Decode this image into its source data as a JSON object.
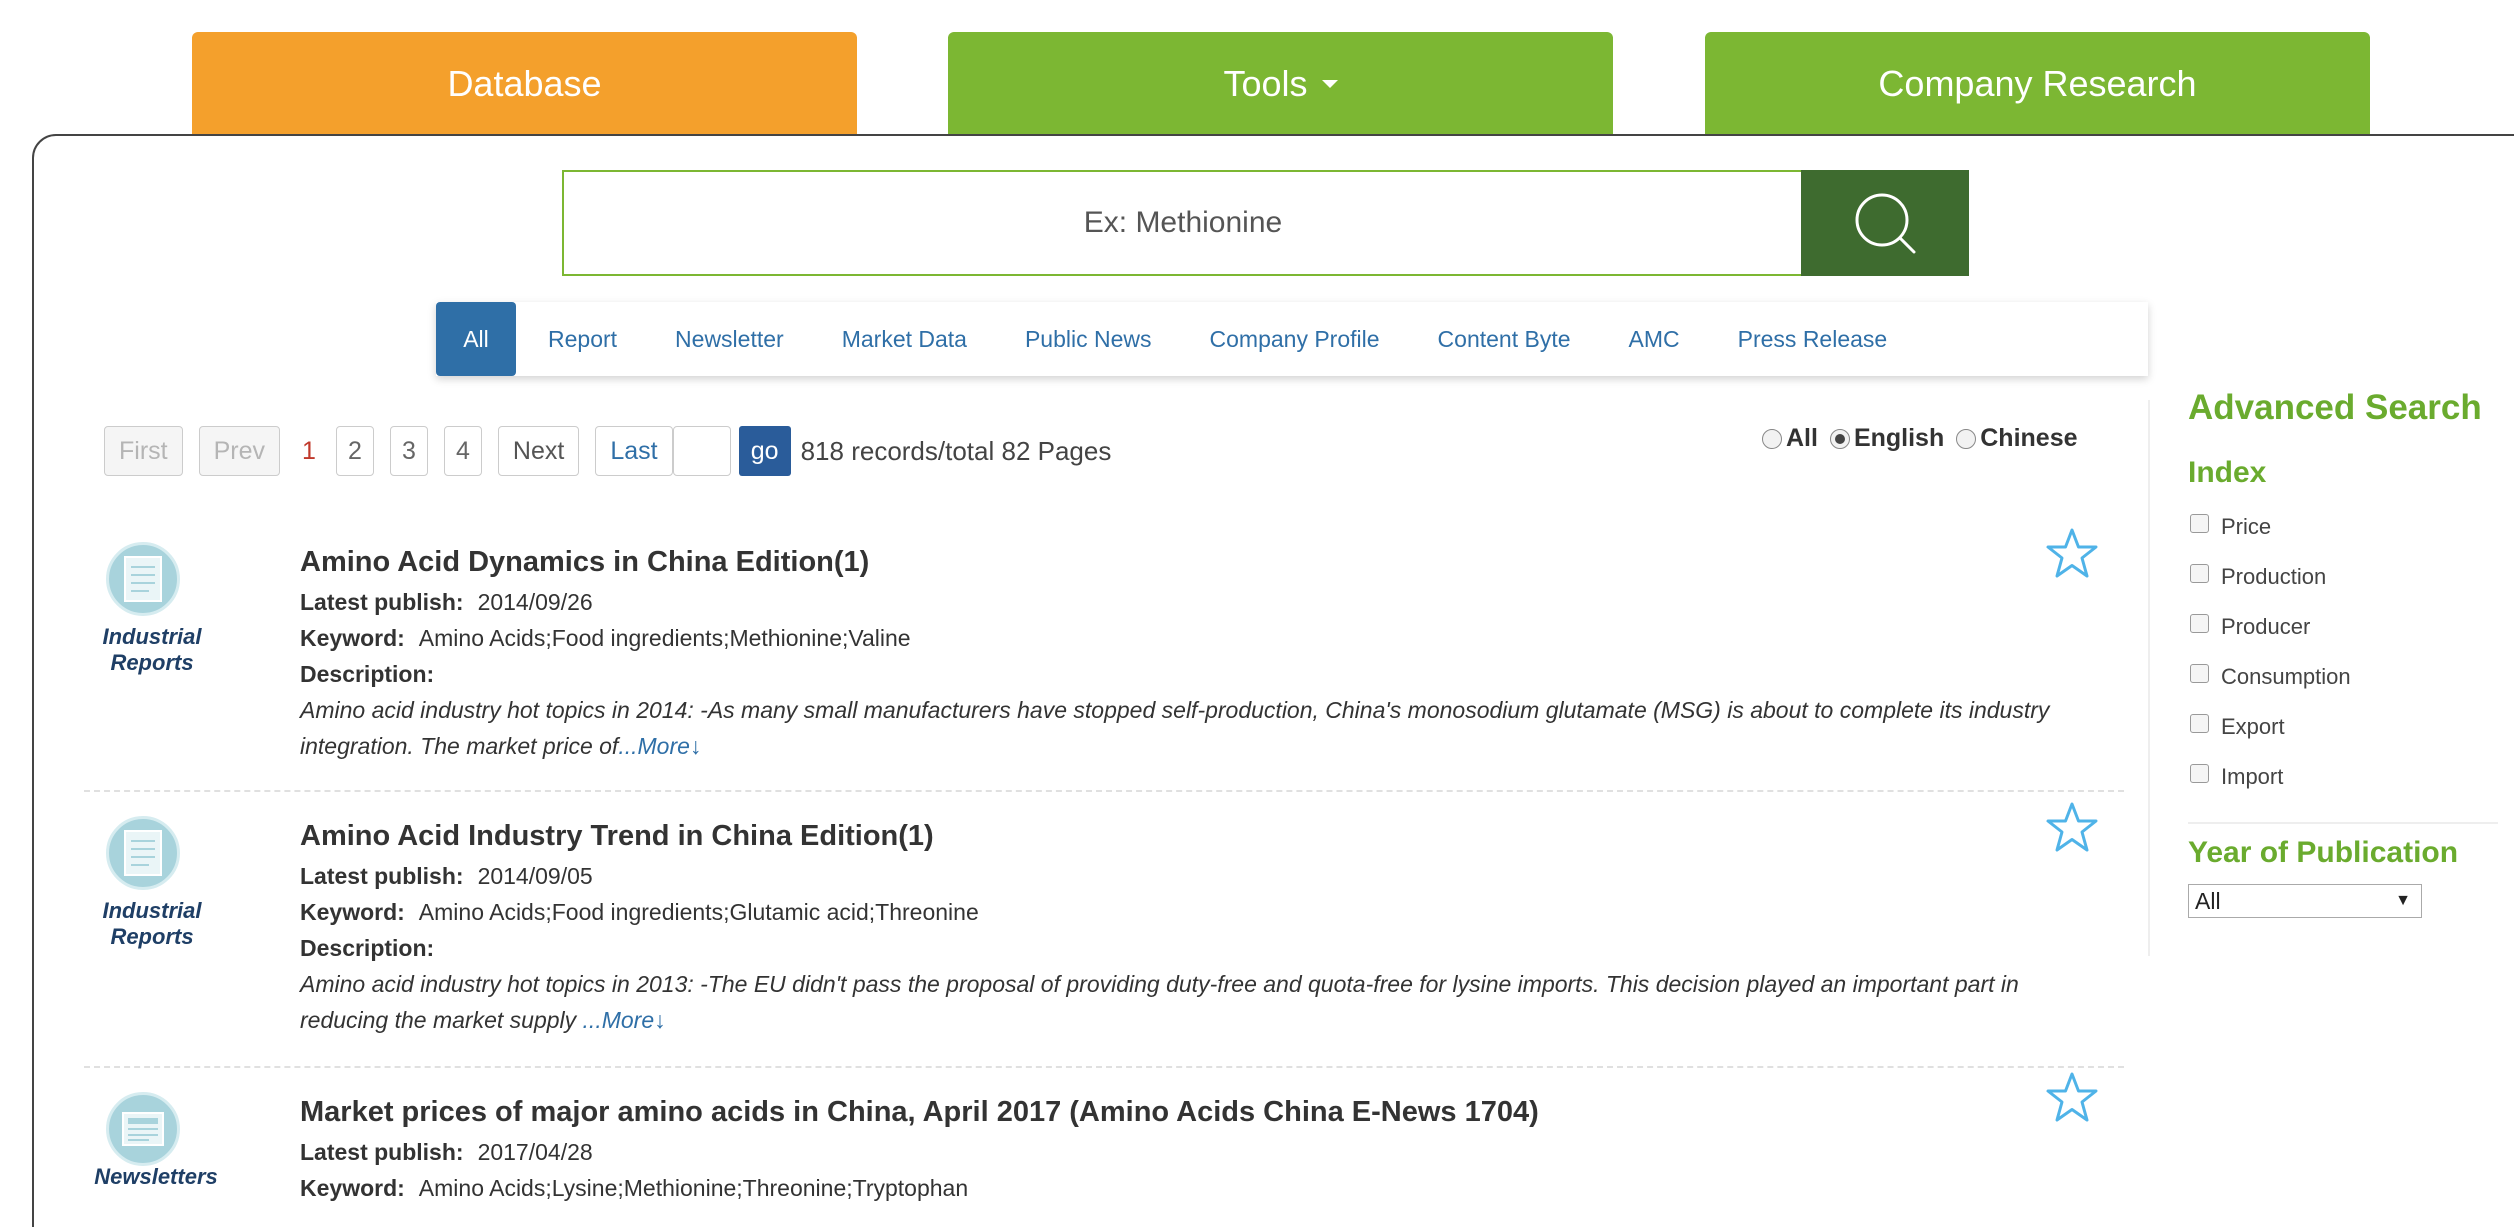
{
  "nav": {
    "database": "Database",
    "tools": "Tools",
    "company_research": "Company Research"
  },
  "search": {
    "placeholder": "Ex: Methionine",
    "button_icon": "search-icon"
  },
  "categories": [
    "All",
    "Report",
    "Newsletter",
    "Market Data",
    "Public News",
    "Company Profile",
    "Content Byte",
    "AMC",
    "Press Release"
  ],
  "active_category": "All",
  "pagination": {
    "first": "First",
    "prev": "Prev",
    "current": "1",
    "pages": [
      "2",
      "3",
      "4"
    ],
    "next": "Next",
    "last": "Last",
    "go": "go",
    "info": "818 records/total 82 Pages"
  },
  "language": {
    "options": [
      "All",
      "English",
      "Chinese"
    ],
    "selected": "English"
  },
  "labels": {
    "latest_publish": "Latest publish:",
    "keyword": "Keyword:",
    "description": "Description:"
  },
  "results": [
    {
      "type_label": "Industrial\nReports",
      "icon": "report-icon",
      "title": "Amino Acid Dynamics in China Edition(1)",
      "date": "2014/09/26",
      "keywords": "Amino Acids;Food ingredients;Methionine;Valine",
      "description": "Amino acid industry hot topics in 2014: -As many small manufacturers have stopped self-production, China's monosodium glutamate (MSG) is about to complete its industry integration. The market price of",
      "more": "...More↓"
    },
    {
      "type_label": "Industrial\nReports",
      "icon": "report-icon",
      "title": "Amino Acid Industry Trend in China Edition(1)",
      "date": "2014/09/05",
      "keywords": "Amino Acids;Food ingredients;Glutamic acid;Threonine",
      "description": "Amino acid industry hot topics in 2013: -The EU didn't pass the proposal of providing duty-free and quota-free for lysine imports. This decision played an important part in reducing the market supply ",
      "more": "...More↓"
    },
    {
      "type_label": "Newsletters",
      "icon": "newsletter-icon",
      "title": "Market prices of major amino acids in China, April 2017 (Amino Acids China E-News 1704)",
      "date": "2017/04/28",
      "keywords": "Amino Acids;Lysine;Methionine;Threonine;Tryptophan"
    }
  ],
  "sidebar": {
    "title": "Advanced Search",
    "index_title": "Index",
    "index_options": [
      "Price",
      "Production",
      "Producer",
      "Consumption",
      "Export",
      "Import"
    ],
    "year_title": "Year of Publication",
    "year_selected": "All"
  },
  "colors": {
    "database_tab": "#f4a02c",
    "green_tab": "#7cb733",
    "search_button": "#3e6b2f",
    "active_category": "#2f6fa7",
    "sidebar_heading": "#6aab2e",
    "star": "#4fb3e8"
  }
}
